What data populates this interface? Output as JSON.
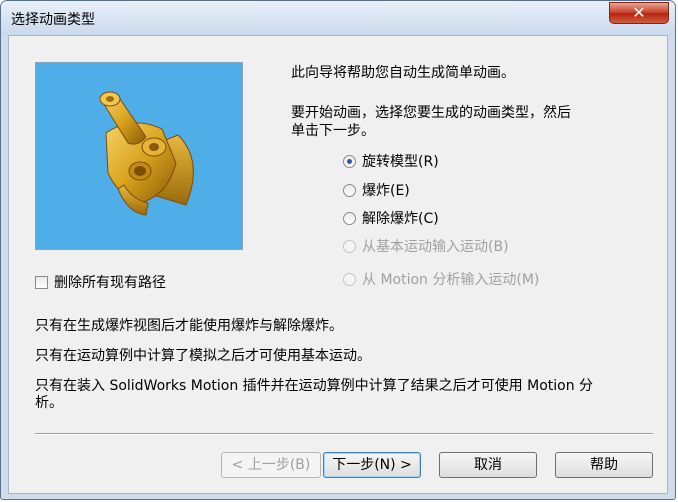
{
  "window": {
    "title": "选择动画类型",
    "close_icon": "close-icon"
  },
  "intro_text": "此向导将帮助您自动生成简单动画。",
  "instruction_text": "要开始动画，选择您要生成的动画类型，然后单击下一步。",
  "options": [
    {
      "label": "旋转模型(R)",
      "checked": true,
      "enabled": true
    },
    {
      "label": "爆炸(E)",
      "checked": false,
      "enabled": true
    },
    {
      "label": "解除爆炸(C)",
      "checked": false,
      "enabled": true
    },
    {
      "label": "从基本运动输入运动(B)",
      "checked": false,
      "enabled": false
    },
    {
      "label": "从 Motion 分析输入运动(M)",
      "checked": false,
      "enabled": false
    }
  ],
  "delete_paths_label": "删除所有现有路径",
  "notes": [
    "只有在生成爆炸视图后才能使用爆炸与解除爆炸。",
    "只有在运动算例中计算了模拟之后才可使用基本运动。",
    "只有在装入 SolidWorks Motion 插件并在运动算例中计算了结果之后才可使用 Motion 分析。"
  ],
  "buttons": {
    "back": "< 上一步(B)",
    "next": "下一步(N) >",
    "cancel": "取消",
    "help": "帮助"
  },
  "colors": {
    "preview_background": "#4faee8",
    "model": "#d9a21c"
  }
}
